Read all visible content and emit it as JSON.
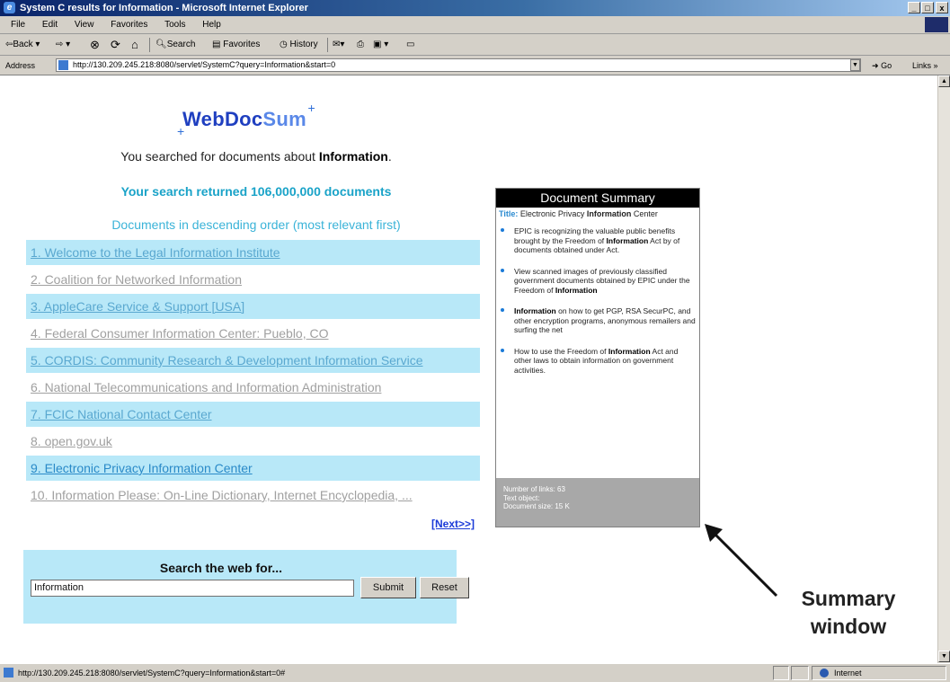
{
  "window": {
    "title": "System C results for Information - Microsoft Internet Explorer",
    "buttons": {
      "minimize": "_",
      "maximize": "□",
      "close": "x"
    }
  },
  "menu": [
    "File",
    "Edit",
    "View",
    "Favorites",
    "Tools",
    "Help"
  ],
  "toolbar": {
    "back": "⇦Back",
    "forward": "⇨",
    "search": "Search",
    "favorites": "Favorites",
    "history": "History"
  },
  "address": {
    "label": "Address",
    "url": "http://130.209.245.218:8080/servlet/SystemC?query=Information&start=0",
    "go": "Go",
    "links": "Links »"
  },
  "page": {
    "logo": {
      "plus_left": "+",
      "web": "WebDoc",
      "sum": "Sum",
      "plus_right": "+"
    },
    "searched_prefix": "You searched for documents about ",
    "searched_term": "Information",
    "searched_suffix": ".",
    "results_count": "Your search returned 106,000,000 documents",
    "order_note": "Documents in descending order (most relevant first)",
    "results": [
      "1. Welcome to the Legal Information Institute",
      "2. Coalition for Networked Information",
      "3. AppleCare Service & Support [USA]",
      "4. Federal Consumer Information Center: Pueblo, CO",
      "5. CORDIS: Community Research & Development Information Service",
      "6. National Telecommunications and Information Administration",
      "7. FCIC National Contact Center",
      "8. open.gov.uk",
      "9. Electronic Privacy Information Center",
      "10. Information Please: On-Line Dictionary, Internet Encyclopedia, ..."
    ],
    "next": "[Next>>]",
    "search_box": {
      "title": "Search the web for...",
      "value": "Information",
      "submit": "Submit",
      "reset": "Reset"
    }
  },
  "summary": {
    "header": "Document Summary",
    "title_label": "Title:",
    "title_pre": " Electronic Privacy ",
    "title_bold": "Information",
    "title_post": " Center",
    "bullets": [
      {
        "pre": "EPIC is recognizing the valuable public benefits brought by the Freedom of ",
        "bold": "Information",
        "post": " Act by of documents obtained under Act."
      },
      {
        "pre": "View scanned images of previously classified government documents obtained by EPIC under the Freedom of ",
        "bold": "Information",
        "post": ""
      },
      {
        "pre": "",
        "bold": "Information",
        "post": " on how to get PGP, RSA SecurPC, and other encryption programs, anonymous remailers and surfing the net"
      },
      {
        "pre": "How to use the Freedom of ",
        "bold": "Information",
        "post": " Act and other laws to obtain information on government activities."
      }
    ],
    "footer": [
      "Number of links: 63",
      "Text object:",
      "Document size: 15 K"
    ]
  },
  "annotation": {
    "line1": "Summary",
    "line2": "window"
  },
  "status": {
    "text": "http://130.209.245.218:8080/servlet/SystemC?query=Information&start=0#",
    "zone": "Internet"
  },
  "colors": {
    "row_highlight": "#b8e8f8",
    "link_blue": "#2a8ac8",
    "heading_cyan": "#1aa3c8"
  },
  "icons": [
    "ie-logo-icon",
    "back-icon",
    "stop-icon",
    "refresh-icon",
    "home-icon",
    "search-icon",
    "favorites-icon",
    "history-icon",
    "mail-icon",
    "print-icon",
    "edit-icon",
    "page-icon",
    "go-icon",
    "globe-icon"
  ]
}
